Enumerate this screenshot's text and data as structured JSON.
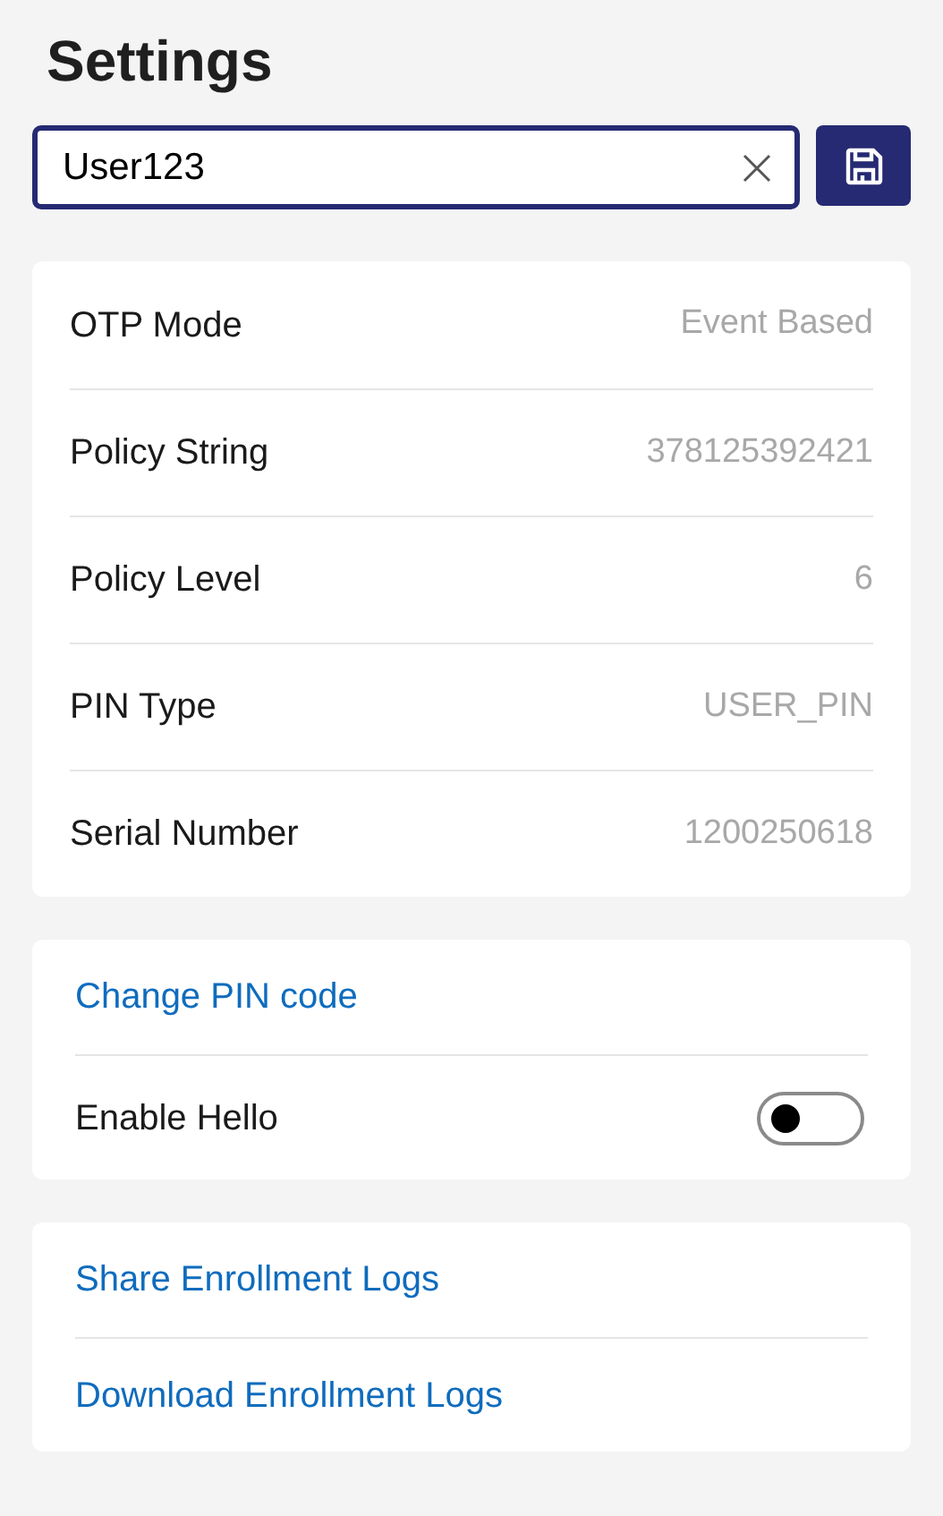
{
  "title": "Settings",
  "user_field": {
    "value": "User123"
  },
  "details": [
    {
      "label": "OTP Mode",
      "value": "Event Based"
    },
    {
      "label": "Policy String",
      "value": "378125392421"
    },
    {
      "label": "Policy Level",
      "value": "6"
    },
    {
      "label": "PIN Type",
      "value": "USER_PIN"
    },
    {
      "label": "Serial Number",
      "value": "1200250618"
    }
  ],
  "security": [
    {
      "kind": "link",
      "label": "Change PIN code"
    },
    {
      "kind": "toggle",
      "label": "Enable Hello",
      "on": false
    }
  ],
  "logs": [
    {
      "kind": "link",
      "label": "Share Enrollment Logs"
    },
    {
      "kind": "link",
      "label": "Download Enrollment Logs"
    }
  ]
}
